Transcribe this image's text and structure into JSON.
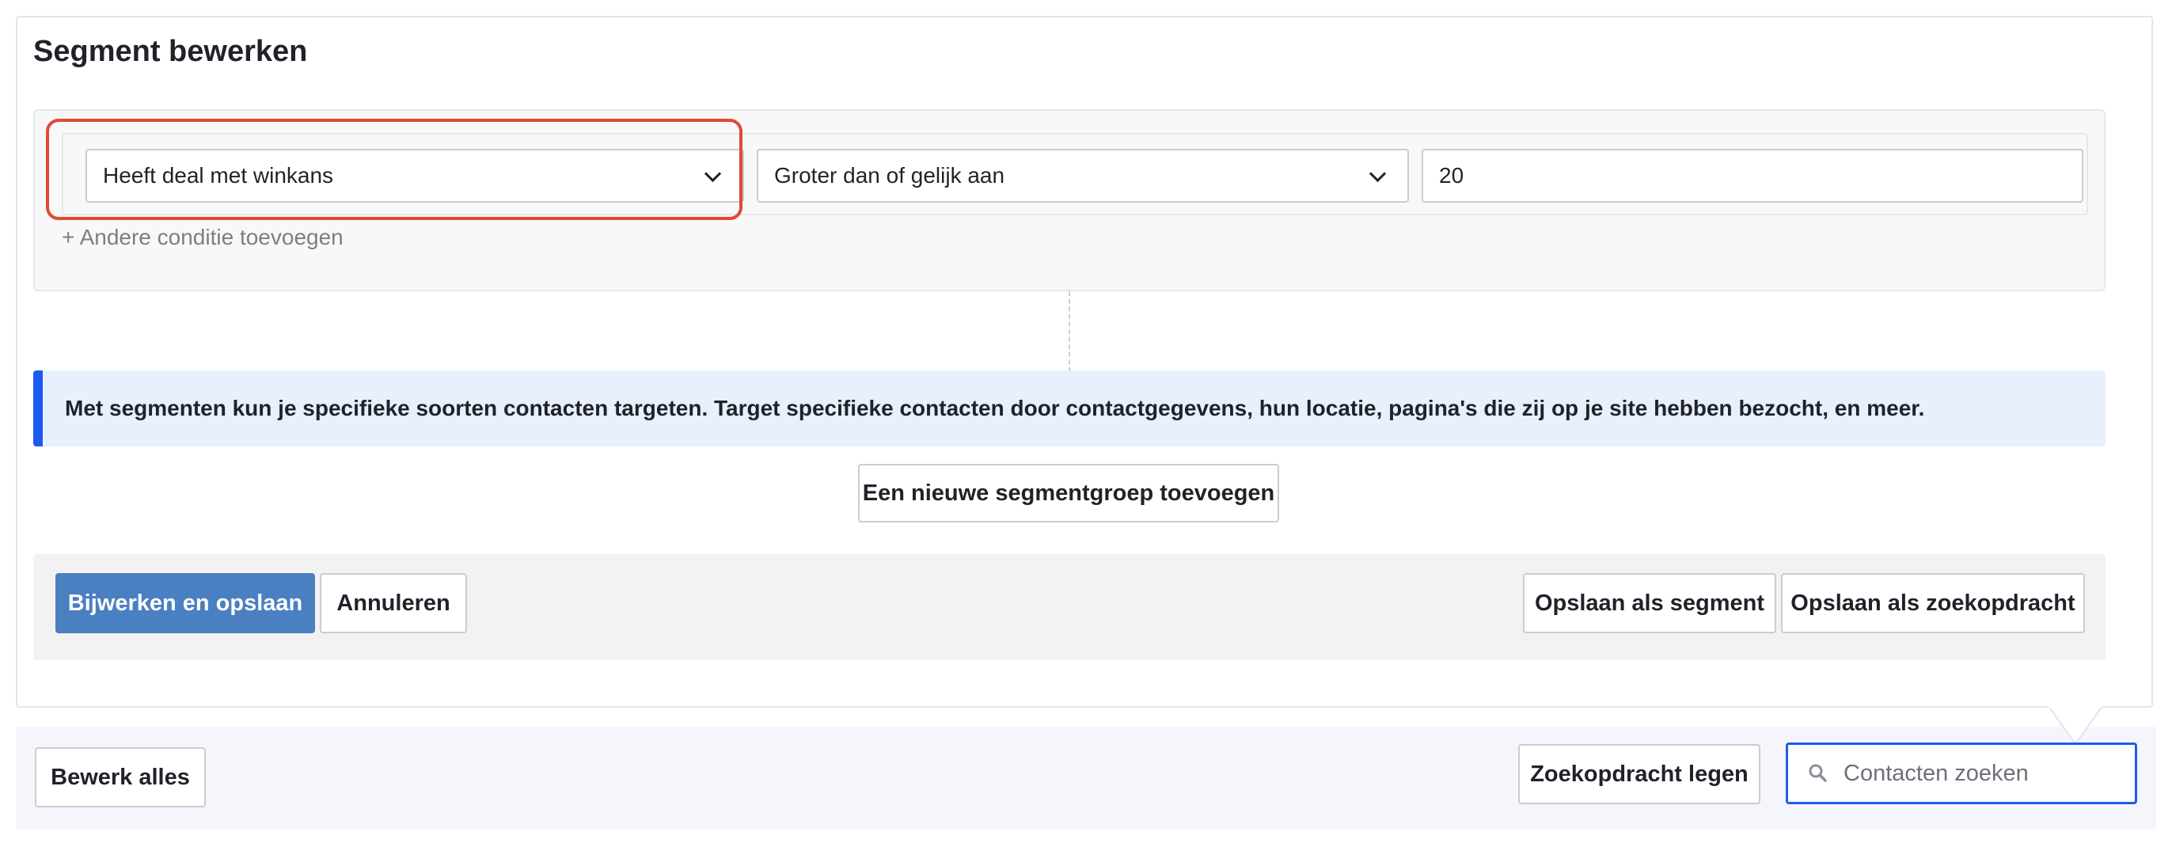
{
  "title": "Segment bewerken",
  "condition": {
    "field_value": "Heeft deal met winkans",
    "operator_value": "Groter dan of gelijk aan",
    "input_value": "20",
    "add_condition_label": "+ Andere conditie toevoegen"
  },
  "info_text": "Met segmenten kun je specifieke soorten contacten targeten. Target specifieke contacten door contactgegevens, hun locatie, pagina's die zij op je site hebben bezocht, en meer.",
  "new_group_label": "Een nieuwe segmentgroep toevoegen",
  "actions": {
    "update_save_label": "Bijwerken en opslaan",
    "cancel_label": "Annuleren",
    "save_segment_label": "Opslaan als segment",
    "save_search_label": "Opslaan als zoekopdracht"
  },
  "bottom": {
    "edit_all_label": "Bewerk alles",
    "clear_search_label": "Zoekopdracht legen",
    "search_placeholder": "Contacten zoeken"
  },
  "icons": {
    "field_dropdown": "chevron-down-icon",
    "operator_dropdown": "chevron-down-icon",
    "search": "search-icon"
  },
  "colors": {
    "primary_button": "#4a7fc1",
    "info_accent": "#1d5bf0",
    "highlight_outline": "#e04a35"
  }
}
